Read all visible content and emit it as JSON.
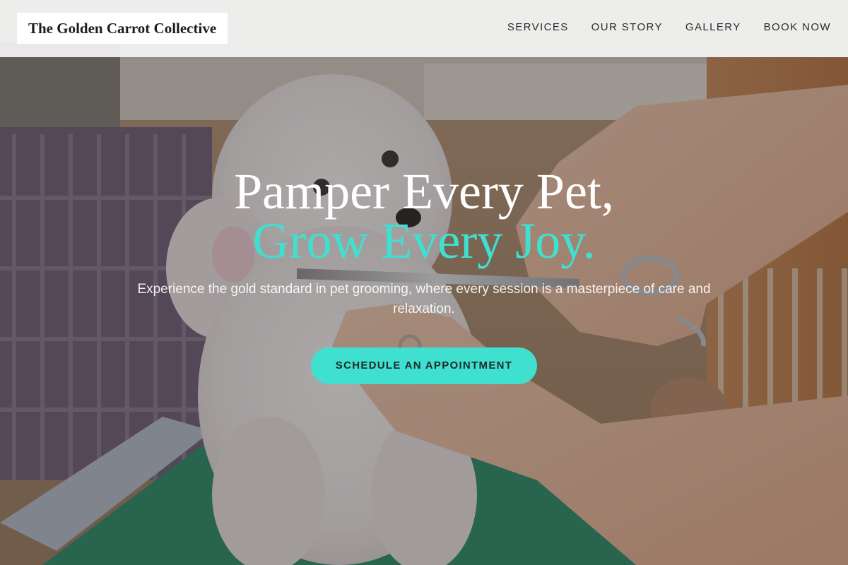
{
  "brand": {
    "name": "The Golden Carrot Collective"
  },
  "nav": {
    "items": [
      {
        "label": "SERVICES"
      },
      {
        "label": "OUR STORY"
      },
      {
        "label": "GALLERY"
      },
      {
        "label": "BOOK NOW"
      }
    ]
  },
  "hero": {
    "headline_line1": "Pamper Every Pet,",
    "headline_line2": "Grow Every Joy.",
    "subtitle": "Experience the gold standard in pet grooming, where every session is a masterpiece of care and relaxation.",
    "cta_label": "SCHEDULE AN APPOINTMENT",
    "background_image": "groomer trimming a white poodle with scissors on a green grooming table"
  },
  "colors": {
    "accent": "#40e0d0",
    "header_bg": "#f4f4f4",
    "text_dark": "#1c1c1c",
    "text_light": "#ffffff"
  }
}
